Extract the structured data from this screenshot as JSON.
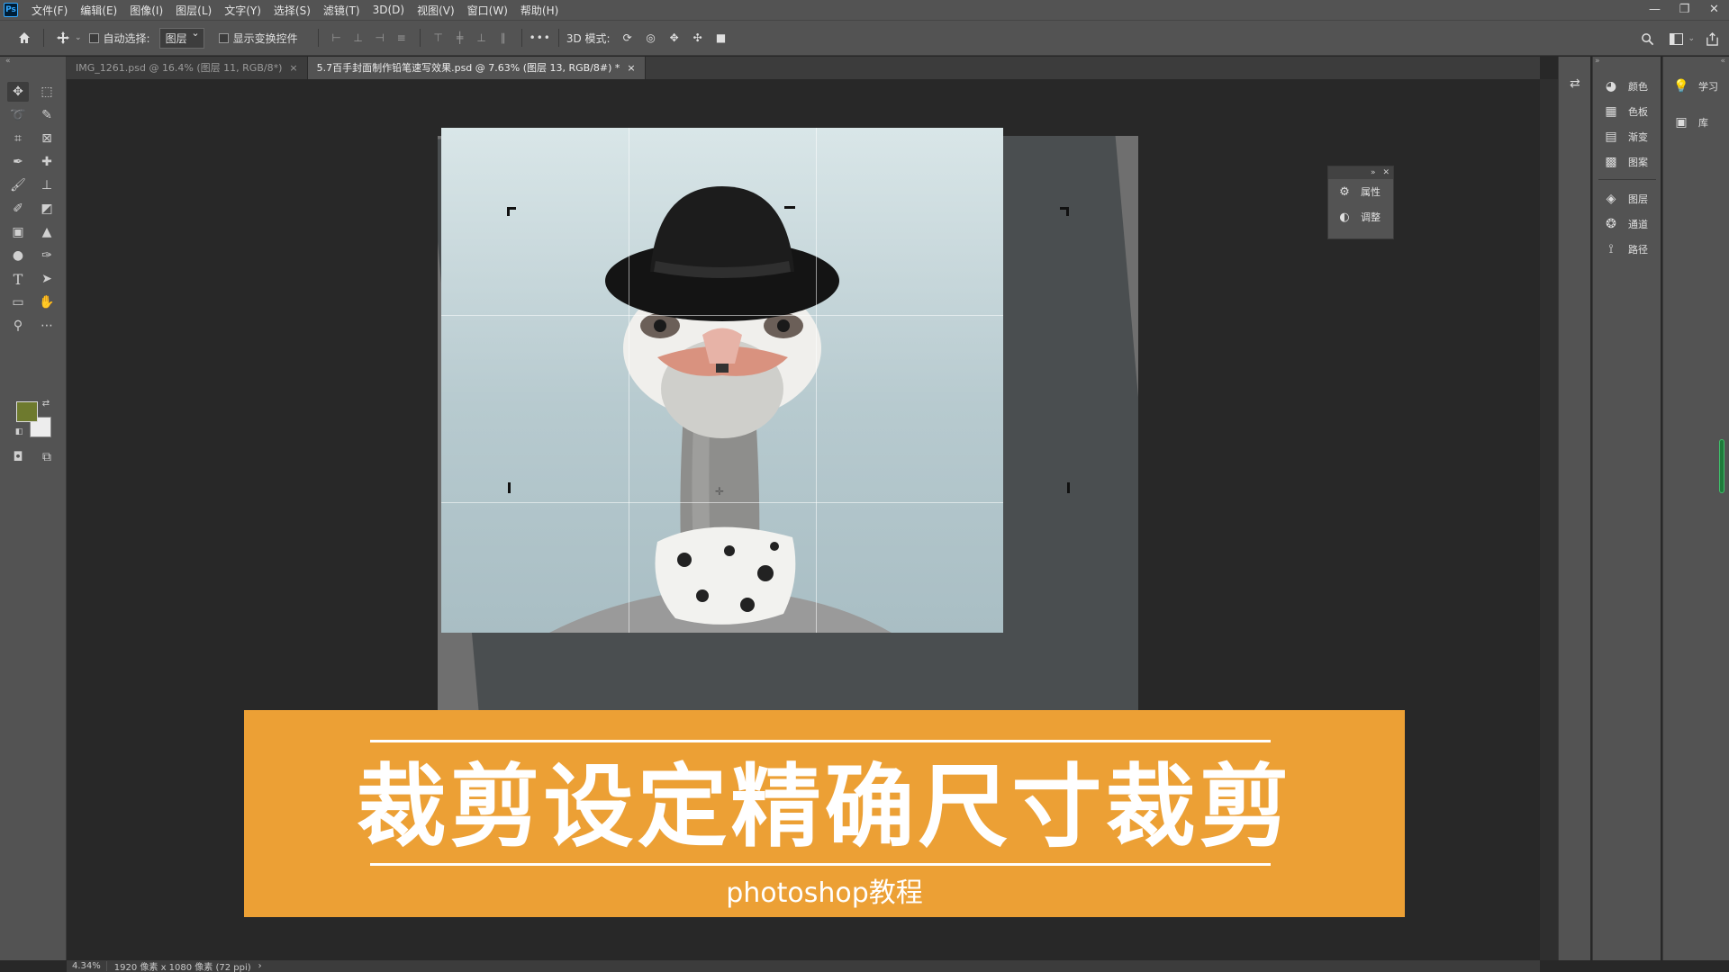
{
  "app": {
    "logo": "Ps"
  },
  "menu": [
    "文件(F)",
    "编辑(E)",
    "图像(I)",
    "图层(L)",
    "文字(Y)",
    "选择(S)",
    "滤镜(T)",
    "3D(D)",
    "视图(V)",
    "窗口(W)",
    "帮助(H)"
  ],
  "window_controls": {
    "minimize": "—",
    "restore": "❐",
    "close": "✕"
  },
  "options": {
    "auto_select_label": "自动选择:",
    "auto_select_value": "图层",
    "show_transform_label": "显示变换控件",
    "more": "•••",
    "mode_3d_label": "3D 模式:"
  },
  "tabs": [
    {
      "label": "IMG_1261.psd @ 16.4% (图层 11, RGB/8*)",
      "close": "×"
    },
    {
      "label": "5.7百手封面制作铅笔速写效果.psd @ 7.63% (图层 13, RGB/8#) *",
      "close": "×"
    }
  ],
  "tools": [
    "move-icon",
    "marquee-icon",
    "lasso-icon",
    "quick-select-icon",
    "crop-icon",
    "frame-icon",
    "eyedropper-icon",
    "healing-icon",
    "brush-icon",
    "stamp-icon",
    "history-brush-icon",
    "eraser-icon",
    "gradient-icon",
    "blur-icon",
    "dodge-icon",
    "pen-icon",
    "text-icon",
    "path-select-icon",
    "rectangle-icon",
    "hand-icon",
    "zoom-icon",
    "more-tools-icon"
  ],
  "colors": {
    "foreground": "#6e7a2e",
    "background": "#ededed",
    "banner": "#eca035"
  },
  "floating_panel": {
    "items": [
      {
        "label": "属性",
        "icon": "properties-icon"
      },
      {
        "label": "调整",
        "icon": "adjust-icon"
      }
    ]
  },
  "panels_col1": [
    {
      "label": "颜色",
      "icon": "color-icon"
    },
    {
      "label": "色板",
      "icon": "swatches-icon"
    },
    {
      "label": "渐变",
      "icon": "gradient-panel-icon"
    },
    {
      "label": "图案",
      "icon": "pattern-icon"
    },
    {
      "label": "图层",
      "icon": "layers-icon"
    },
    {
      "label": "通道",
      "icon": "channels-icon"
    },
    {
      "label": "路径",
      "icon": "paths-icon"
    }
  ],
  "panels_col2": [
    {
      "label": "学习",
      "icon": "learn-icon"
    },
    {
      "label": "库",
      "icon": "library-icon"
    }
  ],
  "banner": {
    "title": "裁剪设定精确尺寸裁剪",
    "subtitle": "photoshop教程"
  },
  "status": {
    "zoom": "4.34%",
    "dimensions": "1920 像素 x 1080 像素 (72 ppi)",
    "arrow": "›"
  }
}
